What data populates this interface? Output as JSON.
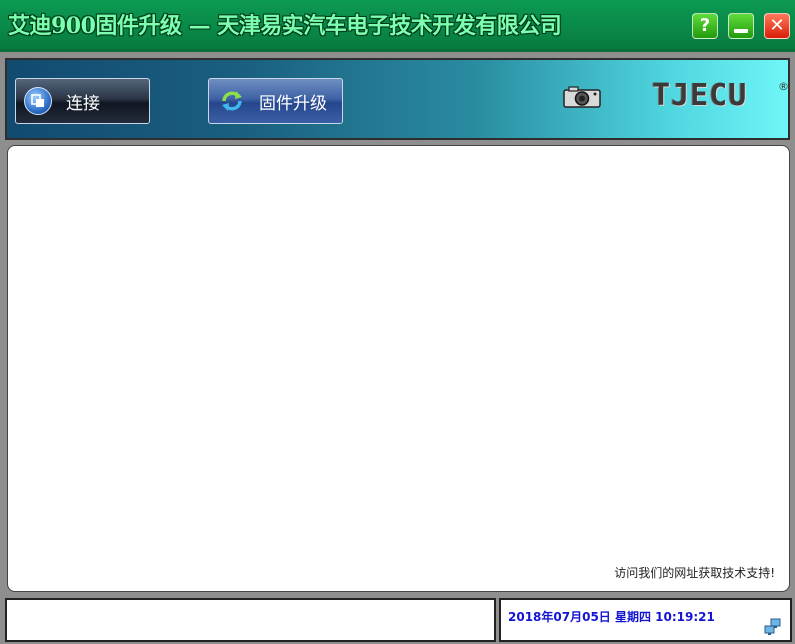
{
  "window": {
    "title": "艾迪900固件升级 — 天津易实汽车电子技术开发有限公司",
    "help_glyph": "?",
    "close_glyph": "✕"
  },
  "toolbar": {
    "connect_label": "连接",
    "upgrade_label": "固件升级",
    "logo_text": "TJECU",
    "logo_reg": "®"
  },
  "main": {
    "support_text": "访问我们的网址获取技术支持!"
  },
  "status": {
    "datetime": "2018年07月05日  星期四  10:19:21"
  },
  "colors": {
    "titlebar": "#0a8a48",
    "title_text": "#7dffb0",
    "datetime_text": "#1414d2"
  }
}
